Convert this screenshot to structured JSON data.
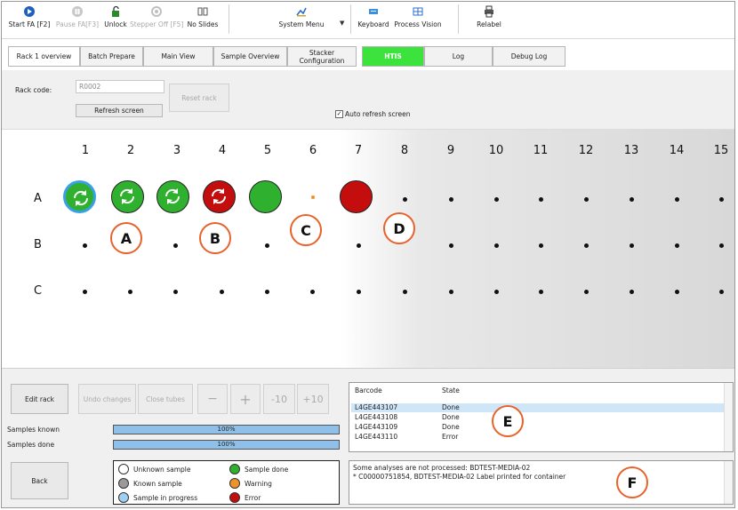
{
  "toolbar": {
    "items": [
      {
        "label": "Start FA [F2]",
        "icon": "start-icon",
        "enabled": true
      },
      {
        "label": "Pause FA[F3]",
        "icon": "pause-icon",
        "enabled": false
      },
      {
        "label": "Unlock",
        "icon": "unlock-icon",
        "enabled": true
      },
      {
        "label": "Stepper Off [F5]",
        "icon": "stepper-icon",
        "enabled": false
      },
      {
        "label": "No Slides",
        "icon": "no-slides-icon",
        "enabled": true
      },
      {
        "label": "System Menu",
        "icon": "system-menu-icon",
        "enabled": true
      },
      {
        "label": "Keyboard",
        "icon": "keyboard-icon",
        "enabled": true
      },
      {
        "label": "Process Vision",
        "icon": "process-vision-icon",
        "enabled": true
      },
      {
        "label": "Relabel",
        "icon": "printer-icon",
        "enabled": true
      }
    ]
  },
  "tabs": [
    {
      "label": "Rack 1 overview"
    },
    {
      "label": "Batch Prepare"
    },
    {
      "label": "Main View"
    },
    {
      "label": "Sample Overview"
    },
    {
      "label": "Stacker Configuration"
    },
    {
      "label": "HTIS"
    },
    {
      "label": "Log"
    },
    {
      "label": "Debug Log"
    }
  ],
  "rack": {
    "code_label": "Rack code:",
    "code_value": "R0002",
    "refresh_button": "Refresh screen",
    "reset_button": "Reset rack",
    "auto_refresh_label": "Auto refresh screen",
    "auto_refresh_checked": true
  },
  "grid": {
    "columns": [
      "1",
      "2",
      "3",
      "4",
      "5",
      "6",
      "7",
      "8",
      "9",
      "10",
      "11",
      "12",
      "13",
      "14",
      "15"
    ],
    "rows": [
      "A",
      "B",
      "C"
    ],
    "annotations": [
      "A",
      "B",
      "C",
      "D",
      "E",
      "F"
    ]
  },
  "colors": {
    "green": "#2fb12f",
    "red": "#c40d0d",
    "orange": "#f0922a",
    "blue": "#3aa0e6",
    "htis_tab": "#3de33d",
    "annotation_ring": "#e8622c"
  },
  "controls": {
    "edit_rack": "Edit rack",
    "undo_changes": "Undo changes",
    "close_tubes": "Close tubes",
    "minus": "−",
    "plus": "+",
    "minus10": "-10",
    "plus10": "+10",
    "back": "Back"
  },
  "progress": {
    "known_label": "Samples known",
    "known_value": 100,
    "known_text": "100%",
    "done_label": "Samples done",
    "done_value": 100,
    "done_text": "100%"
  },
  "legend": [
    {
      "label": "Unknown sample",
      "color": "#ffffff"
    },
    {
      "label": "Known sample",
      "color": "#9a9a9a"
    },
    {
      "label": "Sample in progress",
      "color": "#9fd0f3"
    },
    {
      "label": "Sample done",
      "color": "#2fb12f"
    },
    {
      "label": "Warning",
      "color": "#f0922a"
    },
    {
      "label": "Error",
      "color": "#c40d0d"
    }
  ],
  "samples": {
    "headers": [
      "Barcode",
      "State"
    ],
    "rows": [
      {
        "barcode": "L4GE443107",
        "state": "Done",
        "selected": true
      },
      {
        "barcode": "L4GE443108",
        "state": "Done",
        "selected": false
      },
      {
        "barcode": "L4GE443109",
        "state": "Done",
        "selected": false
      },
      {
        "barcode": "L4GE443110",
        "state": "Error",
        "selected": false
      }
    ]
  },
  "messages": [
    "Some analyses are not processed: BDTEST-MEDIA-02",
    "* C00000751854, BDTEST-MEDIA-02 Label printed for container"
  ]
}
